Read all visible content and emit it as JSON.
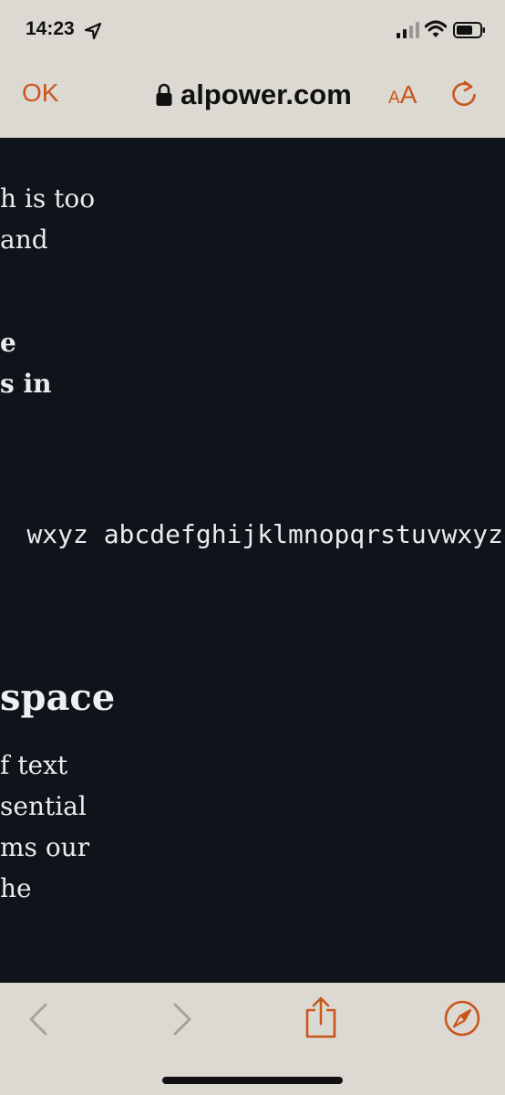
{
  "status_bar": {
    "time": "14:23",
    "icons": [
      "location-arrow-icon",
      "cellular-signal-icon",
      "wifi-icon",
      "battery-icon"
    ]
  },
  "browser": {
    "done_label": "OK",
    "url": "alpower.com",
    "text_size_label_small": "A",
    "text_size_label_large": "A",
    "accent_color": "#c8561c",
    "chrome_color": "#dcd8d2"
  },
  "page": {
    "background_color": "#0f141b",
    "paragraph1": [
      "h is too",
      "and"
    ],
    "paragraph2_bold": [
      "e",
      "s in"
    ],
    "mono_sample": "wxyz abcdefghijklmnopqrstuvwxyz",
    "heading": "space",
    "paragraph3": [
      "f text",
      "sential",
      "ms our",
      "he"
    ]
  },
  "toolbar": {
    "icons": [
      "back-arrow-icon",
      "forward-arrow-icon",
      "share-icon",
      "compass-icon"
    ],
    "back_enabled": false,
    "forward_enabled": false
  }
}
